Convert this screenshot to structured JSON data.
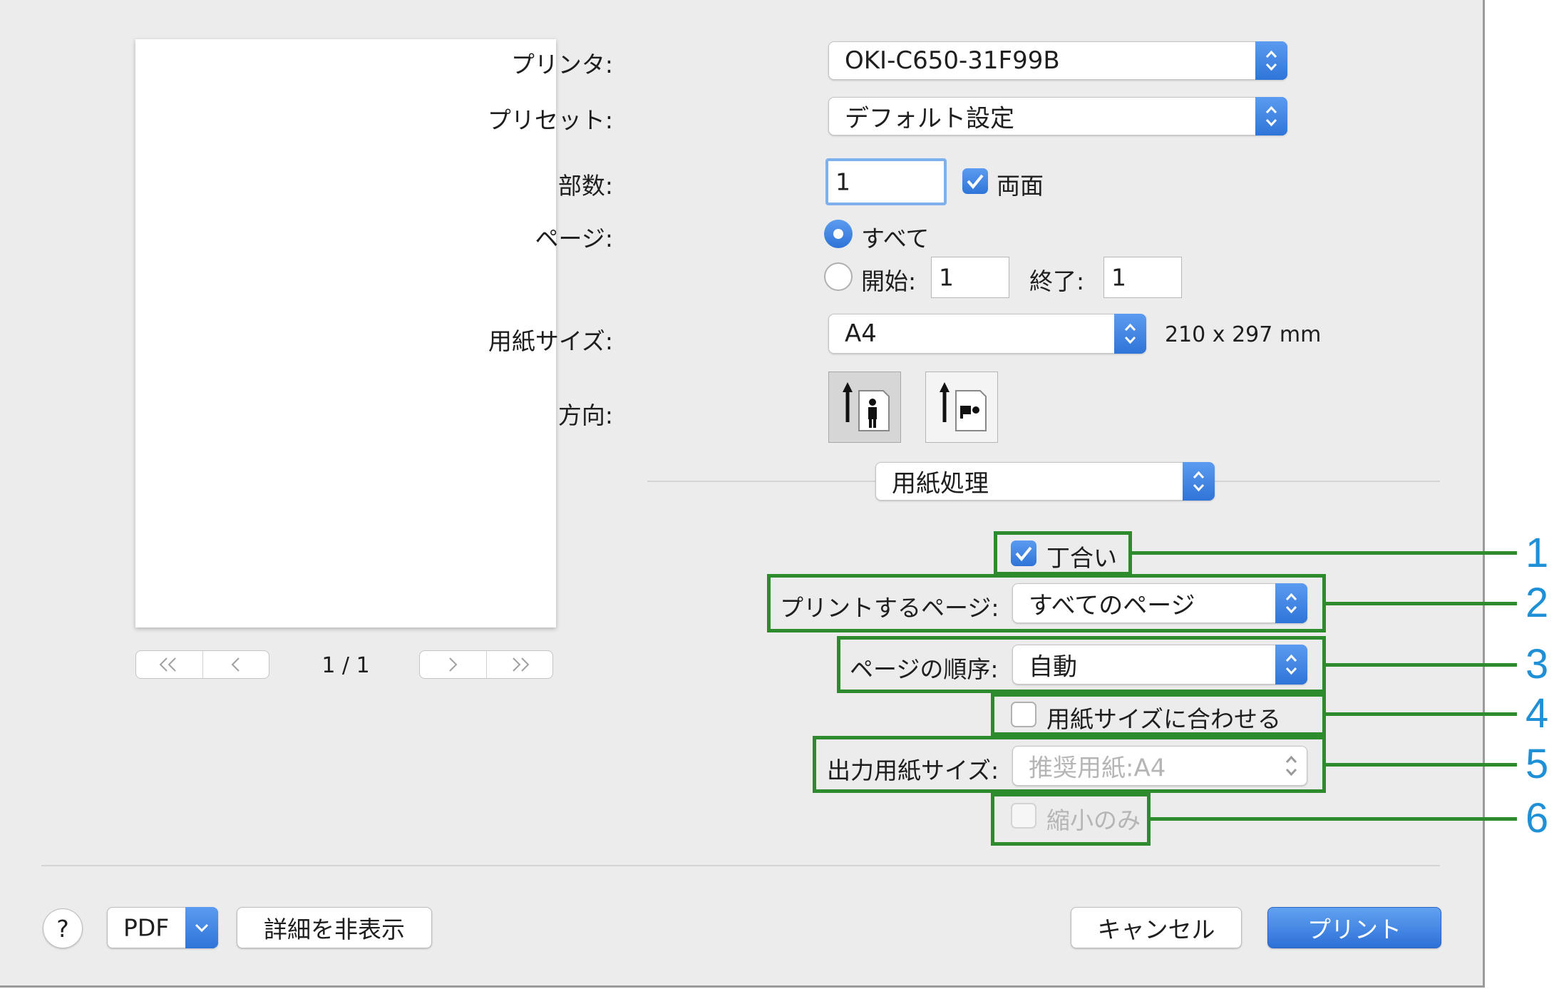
{
  "printer": {
    "label": "プリンタ:",
    "value": "OKI-C650-31F99B"
  },
  "preset": {
    "label": "プリセット:",
    "value": "デフォルト設定"
  },
  "copies": {
    "label": "部数:",
    "value": "1",
    "duplex_label": "両面",
    "duplex_checked": true
  },
  "pages": {
    "label": "ページ:",
    "all_label": "すべて",
    "range_label": "開始:",
    "from": "1",
    "to_label": "終了:",
    "to": "1"
  },
  "paper_size": {
    "label": "用紙サイズ:",
    "value": "A4",
    "dimensions": "210 x 297 mm"
  },
  "orientation": {
    "label": "方向:"
  },
  "section": {
    "value": "用紙処理"
  },
  "paper_handling": {
    "collate_label": "丁合い",
    "collate_checked": true,
    "pages_to_print_label": "プリントするページ:",
    "pages_to_print_value": "すべてのページ",
    "page_order_label": "ページの順序:",
    "page_order_value": "自動",
    "scale_to_fit_label": "用紙サイズに合わせる",
    "dest_size_label": "出力用紙サイズ:",
    "dest_size_value": "推奨用紙:A4",
    "scale_down_only_label": "縮小のみ"
  },
  "preview": {
    "page_indicator": "1 / 1"
  },
  "footer": {
    "help": "?",
    "pdf": "PDF",
    "hide_details": "詳細を非表示",
    "cancel": "キャンセル",
    "print": "プリント"
  },
  "callouts": [
    "1",
    "2",
    "3",
    "4",
    "5",
    "6"
  ],
  "colors": {
    "accent": "#2f74d8",
    "callout_frame": "#2d8a2d",
    "callout_number": "#1f8fd6"
  }
}
